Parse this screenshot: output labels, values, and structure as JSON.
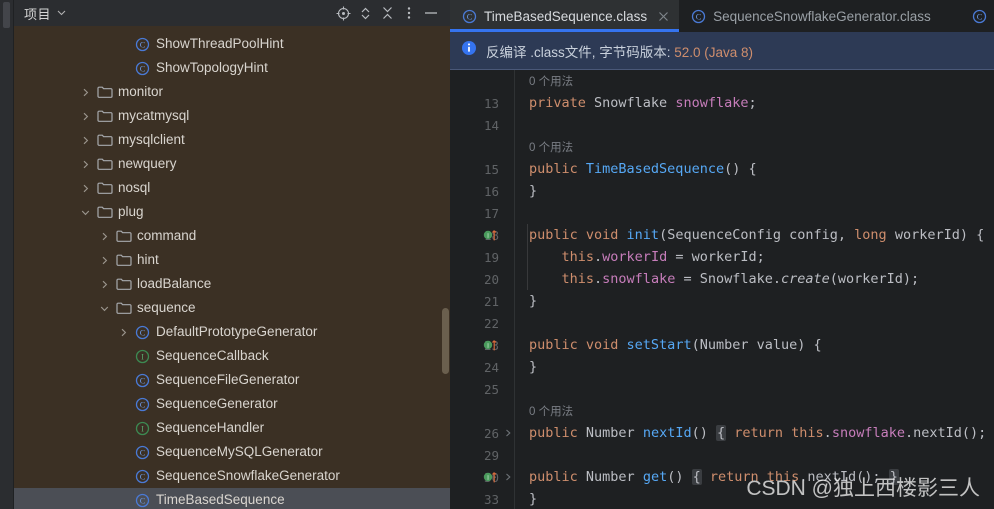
{
  "project_panel": {
    "title": "项目",
    "chevron_icon": "chevron-down-icon",
    "toolbar_icons": [
      {
        "name": "locate-target-icon",
        "glyph": "target"
      },
      {
        "name": "expand-collapse-icon",
        "glyph": "diamond-chevrons"
      },
      {
        "name": "collapse-all-icon",
        "glyph": "x-collapse"
      },
      {
        "name": "more-options-icon",
        "glyph": "kebab"
      },
      {
        "name": "hide-panel-icon",
        "glyph": "minus"
      }
    ],
    "tree": [
      {
        "label": "ShowThreadPoolHint",
        "indent": 5,
        "arrow": "none",
        "icon": "class-icon",
        "selected": false
      },
      {
        "label": "ShowTopologyHint",
        "indent": 5,
        "arrow": "none",
        "icon": "class-icon",
        "selected": false
      },
      {
        "label": "monitor",
        "indent": 3,
        "arrow": "collapsed",
        "icon": "folder-icon",
        "selected": false
      },
      {
        "label": "mycatmysql",
        "indent": 3,
        "arrow": "collapsed",
        "icon": "folder-icon",
        "selected": false
      },
      {
        "label": "mysqlclient",
        "indent": 3,
        "arrow": "collapsed",
        "icon": "folder-icon",
        "selected": false
      },
      {
        "label": "newquery",
        "indent": 3,
        "arrow": "collapsed",
        "icon": "folder-icon",
        "selected": false
      },
      {
        "label": "nosql",
        "indent": 3,
        "arrow": "collapsed",
        "icon": "folder-icon",
        "selected": false
      },
      {
        "label": "plug",
        "indent": 3,
        "arrow": "expanded",
        "icon": "folder-icon",
        "selected": false
      },
      {
        "label": "command",
        "indent": 4,
        "arrow": "collapsed",
        "icon": "folder-icon",
        "selected": false
      },
      {
        "label": "hint",
        "indent": 4,
        "arrow": "collapsed",
        "icon": "folder-icon",
        "selected": false
      },
      {
        "label": "loadBalance",
        "indent": 4,
        "arrow": "collapsed",
        "icon": "folder-icon",
        "selected": false
      },
      {
        "label": "sequence",
        "indent": 4,
        "arrow": "expanded",
        "icon": "folder-icon",
        "selected": false
      },
      {
        "label": "DefaultPrototypeGenerator",
        "indent": 5,
        "arrow": "collapsed",
        "icon": "class-icon",
        "selected": false
      },
      {
        "label": "SequenceCallback",
        "indent": 5,
        "arrow": "none",
        "icon": "interface-icon",
        "selected": false
      },
      {
        "label": "SequenceFileGenerator",
        "indent": 5,
        "arrow": "none",
        "icon": "class-icon",
        "selected": false
      },
      {
        "label": "SequenceGenerator",
        "indent": 5,
        "arrow": "none",
        "icon": "class-icon",
        "selected": false
      },
      {
        "label": "SequenceHandler",
        "indent": 5,
        "arrow": "none",
        "icon": "interface-icon",
        "selected": false
      },
      {
        "label": "SequenceMySQLGenerator",
        "indent": 5,
        "arrow": "none",
        "icon": "class-icon",
        "selected": false
      },
      {
        "label": "SequenceSnowflakeGenerator",
        "indent": 5,
        "arrow": "none",
        "icon": "class-icon",
        "selected": false
      },
      {
        "label": "TimeBasedSequence",
        "indent": 5,
        "arrow": "none",
        "icon": "class-icon",
        "selected": true
      }
    ]
  },
  "editor": {
    "tabs": [
      {
        "label": "TimeBasedSequence.class",
        "icon": "class-icon",
        "active": true,
        "closable": true
      },
      {
        "label": "SequenceSnowflakeGenerator.class",
        "icon": "class-icon",
        "active": false,
        "closable": false
      }
    ],
    "partial_tab_icon": "class-icon",
    "close_icon": "close-icon",
    "notice": {
      "icon": "info-icon",
      "text": "反编译 .class文件, 字节码版本: 52.0 (Java 8)",
      "prefix": "反编译 .class文件, 字节码版本: ",
      "version": "52.0 (Java 8)"
    },
    "usage_hint": "0 个用法",
    "lines": [
      {
        "num": "",
        "kind": "usage",
        "text": "0 个用法"
      },
      {
        "num": "13",
        "kind": "code",
        "tokens": [
          {
            "t": "private ",
            "c": "kw"
          },
          {
            "t": "Snowflake ",
            "c": "typ"
          },
          {
            "t": "snowflake",
            "c": "fld"
          },
          {
            "t": ";",
            "c": "pln"
          }
        ]
      },
      {
        "num": "14",
        "kind": "code",
        "tokens": []
      },
      {
        "num": "",
        "kind": "usage",
        "text": "0 个用法"
      },
      {
        "num": "15",
        "kind": "code",
        "tokens": [
          {
            "t": "public ",
            "c": "kw"
          },
          {
            "t": "TimeBasedSequence",
            "c": "fn"
          },
          {
            "t": "() {",
            "c": "pln"
          }
        ]
      },
      {
        "num": "16",
        "kind": "code",
        "tokens": [
          {
            "t": "}",
            "c": "pln"
          }
        ]
      },
      {
        "num": "17",
        "kind": "code",
        "tokens": []
      },
      {
        "num": "18",
        "kind": "code",
        "mark": "implements-method-icon",
        "indent": true,
        "tokens": [
          {
            "t": "public void ",
            "c": "kw"
          },
          {
            "t": "init",
            "c": "fn"
          },
          {
            "t": "(",
            "c": "pln"
          },
          {
            "t": "SequenceConfig ",
            "c": "typ"
          },
          {
            "t": "config",
            "c": "pln"
          },
          {
            "t": ", ",
            "c": "pln"
          },
          {
            "t": "long ",
            "c": "kw"
          },
          {
            "t": "workerId",
            "c": "pln"
          },
          {
            "t": ") {",
            "c": "pln"
          }
        ]
      },
      {
        "num": "19",
        "kind": "code",
        "indent": true,
        "tokens": [
          {
            "t": "    ",
            "c": "pln"
          },
          {
            "t": "this",
            "c": "kw"
          },
          {
            "t": ".",
            "c": "pln"
          },
          {
            "t": "workerId",
            "c": "fld"
          },
          {
            "t": " = workerId;",
            "c": "pln"
          }
        ]
      },
      {
        "num": "20",
        "kind": "code",
        "indent": true,
        "tokens": [
          {
            "t": "    ",
            "c": "pln"
          },
          {
            "t": "this",
            "c": "kw"
          },
          {
            "t": ".",
            "c": "pln"
          },
          {
            "t": "snowflake",
            "c": "fld"
          },
          {
            "t": " = Snowflake.",
            "c": "pln"
          },
          {
            "t": "create",
            "c": "ital"
          },
          {
            "t": "(workerId);",
            "c": "pln"
          }
        ]
      },
      {
        "num": "21",
        "kind": "code",
        "tokens": [
          {
            "t": "}",
            "c": "pln"
          }
        ]
      },
      {
        "num": "22",
        "kind": "code",
        "tokens": []
      },
      {
        "num": "23",
        "kind": "code",
        "mark": "implements-method-icon",
        "tokens": [
          {
            "t": "public void ",
            "c": "kw"
          },
          {
            "t": "setStart",
            "c": "fn"
          },
          {
            "t": "(",
            "c": "pln"
          },
          {
            "t": "Number ",
            "c": "typ"
          },
          {
            "t": "value",
            "c": "pln"
          },
          {
            "t": ") {",
            "c": "pln"
          }
        ]
      },
      {
        "num": "24",
        "kind": "code",
        "tokens": [
          {
            "t": "}",
            "c": "pln"
          }
        ]
      },
      {
        "num": "25",
        "kind": "code",
        "tokens": []
      },
      {
        "num": "",
        "kind": "usage",
        "text": "0 个用法"
      },
      {
        "num": "26",
        "kind": "code",
        "fold": "collapsed",
        "tokens": [
          {
            "t": "public ",
            "c": "kw"
          },
          {
            "t": "Number ",
            "c": "typ"
          },
          {
            "t": "nextId",
            "c": "fn"
          },
          {
            "t": "() ",
            "c": "pln"
          },
          {
            "t": "{",
            "c": "chip"
          },
          {
            "t": " return ",
            "c": "kw"
          },
          {
            "t": "this",
            "c": "kw"
          },
          {
            "t": ".",
            "c": "pln"
          },
          {
            "t": "snowflake",
            "c": "fld"
          },
          {
            "t": ".nextId();",
            "c": "pln"
          }
        ]
      },
      {
        "num": "29",
        "kind": "code",
        "tokens": []
      },
      {
        "num": "30",
        "kind": "code",
        "mark": "implements-method-icon",
        "fold": "collapsed",
        "tokens": [
          {
            "t": "public ",
            "c": "kw"
          },
          {
            "t": "Number ",
            "c": "typ"
          },
          {
            "t": "get",
            "c": "fn"
          },
          {
            "t": "() ",
            "c": "pln"
          },
          {
            "t": "{",
            "c": "chip"
          },
          {
            "t": " return ",
            "c": "kw"
          },
          {
            "t": "this",
            "c": "kw"
          },
          {
            "t": ".nextId(); ",
            "c": "pln"
          },
          {
            "t": "}",
            "c": "chip"
          }
        ]
      },
      {
        "num": "33",
        "kind": "code",
        "tokens": [
          {
            "t": "}",
            "c": "pln"
          }
        ]
      }
    ]
  },
  "watermark": "CSDN @独上西楼影三人",
  "colors": {
    "sidebar_bg": "#3b3024",
    "editor_bg": "#1e2022",
    "header_bg": "#2b2d30",
    "tab_active_bg": "#2e3133",
    "tab_underline": "#3574f0",
    "notice_bg": "#2d3a55",
    "selection_bg": "#4b4e55",
    "class_icon": "#4a7ad6",
    "interface_icon": "#3c8a52"
  }
}
